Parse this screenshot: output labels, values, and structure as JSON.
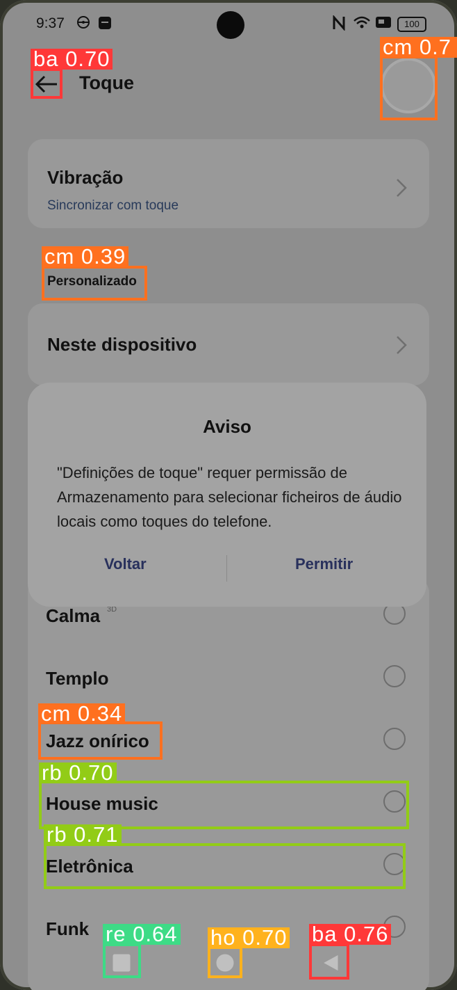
{
  "status_bar": {
    "time": "9:37",
    "icons": [
      "steering-wheel-icon",
      "message-icon",
      "nfc-icon",
      "wifi-icon",
      "card-icon"
    ],
    "battery": "100"
  },
  "header": {
    "title": "Toque"
  },
  "vibration": {
    "title": "Vibração",
    "subtitle": "Sincronizar com toque"
  },
  "section_custom": "Personalizado",
  "device_item": "Neste dispositivo",
  "dialog": {
    "title": "Aviso",
    "body": "\"Definições de toque\" requer permissão de Armazenamento para selecionar ficheiros de áudio locais como toques do telefone.",
    "cancel": "Voltar",
    "confirm": "Permitir"
  },
  "ringtones": [
    {
      "label": "Calma",
      "badge": "3D"
    },
    {
      "label": "Templo"
    },
    {
      "label": "Jazz onírico"
    },
    {
      "label": "House music"
    },
    {
      "label": "Eletrônica"
    },
    {
      "label": "Funk"
    }
  ],
  "detections": [
    {
      "label": "ba 0.70",
      "color": "#ff3838"
    },
    {
      "label": "cm 0.7",
      "color": "#ff701f"
    },
    {
      "label": "cm 0.39",
      "color": "#ff701f"
    },
    {
      "label": "cm 0.34",
      "color": "#ff701f"
    },
    {
      "label": "rb 0.70",
      "color": "#92cc17"
    },
    {
      "label": "rb 0.71",
      "color": "#92cc17"
    },
    {
      "label": "re 0.64",
      "color": "#3ddb86"
    },
    {
      "label": "ho 0.70",
      "color": "#ffb21d"
    },
    {
      "label": "ba 0.76",
      "color": "#ff3838"
    }
  ]
}
